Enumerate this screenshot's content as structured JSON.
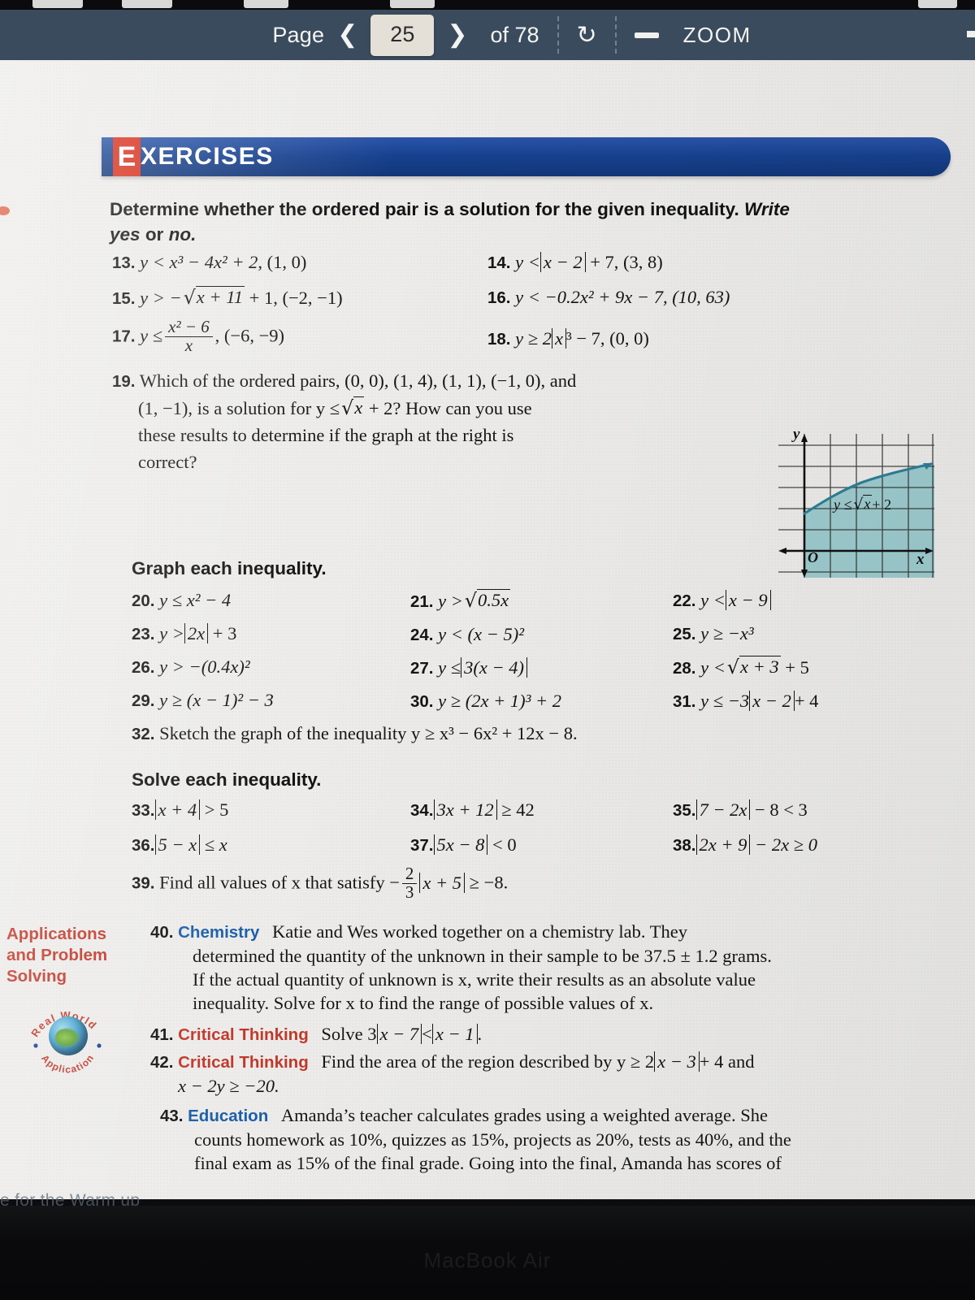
{
  "toolbar": {
    "page_label": "Page",
    "prev_icon": "chevron-left-icon",
    "page_value": "25",
    "next_icon": "chevron-right-icon",
    "of_label": "of 78",
    "reload_icon": "reload-icon",
    "zoom_out_icon": "minus-icon",
    "zoom_label": "ZOOM",
    "bg_color": "#394b5c",
    "page_box_color": "#e4e0d8"
  },
  "banner": {
    "first_letter": "E",
    "rest": "XERCISES",
    "bg_color": "#17418f",
    "accent_color": "#d8301d"
  },
  "section1": {
    "instruction_line1": "Determine whether the ordered pair is a solution for the given inequality.",
    "instruction_italic1": "Write",
    "instruction_italic2": "yes",
    "instruction_plain": "or",
    "instruction_italic3": "no."
  },
  "ex13": {
    "num": "13.",
    "lhs": "y <",
    "expr": "x³ − 4x² + 2",
    "pair": ", (1, 0)"
  },
  "ex14": {
    "num": "14.",
    "lhs": "y <",
    "abs": "x − 2",
    "tail": "+ 7, (3, 8)"
  },
  "ex15": {
    "num": "15.",
    "lhs": "y > −",
    "radicand": "x + 11",
    "tail": "+ 1, (−2, −1)"
  },
  "ex16": {
    "num": "16.",
    "text": "y < −0.2x² + 9x − 7, (10, 63)"
  },
  "ex17": {
    "num": "17.",
    "lhs": "y ≤",
    "frac_num": "x² − 6",
    "frac_den": "x",
    "tail": ", (−6, −9)"
  },
  "ex18": {
    "num": "18.",
    "lhs": "y ≥ 2",
    "abs": "x",
    "tail": "³ − 7, (0, 0)"
  },
  "ex19": {
    "num": "19.",
    "line1": "Which of the ordered pairs, (0, 0), (1, 4), (1, 1), (−1, 0), and",
    "line2a": "(1, −1), is a solution for y ≤",
    "line2b": "x",
    "line2c": "+ 2? How can you use",
    "line3": "these results to determine if the graph at the right is",
    "line4": "correct?",
    "figure": {
      "name": "inequality-graph",
      "y_axis_label": "y",
      "x_axis_label": "x",
      "origin_label": "O",
      "curve_label_prefix": "y ≤",
      "curve_label_radicand": "x",
      "curve_label_suffix": "+ 2",
      "shade_color": "#8ec6c9",
      "curve_color": "#2d7f96"
    }
  },
  "section2": {
    "heading": "Graph each inequality."
  },
  "ex20": {
    "num": "20.",
    "text": "y ≤ x² − 4"
  },
  "ex21": {
    "num": "21.",
    "lhs": "y >",
    "radicand": "0.5x"
  },
  "ex22": {
    "num": "22.",
    "lhs": "y <",
    "abs": "x − 9"
  },
  "ex23": {
    "num": "23.",
    "lhs": "y >",
    "abs": "2x",
    "tail": "+ 3"
  },
  "ex24": {
    "num": "24.",
    "text": "y < (x − 5)²"
  },
  "ex25": {
    "num": "25.",
    "text": "y ≥ −x³"
  },
  "ex26": {
    "num": "26.",
    "text": "y > −(0.4x)²"
  },
  "ex27": {
    "num": "27.",
    "lhs": "y ≤",
    "abs": "3(x − 4)"
  },
  "ex28": {
    "num": "28.",
    "lhs": "y <",
    "radicand": "x + 3",
    "tail": "+ 5"
  },
  "ex29": {
    "num": "29.",
    "text": "y ≥ (x − 1)² − 3"
  },
  "ex30": {
    "num": "30.",
    "text": "y ≥ (2x + 1)³ + 2"
  },
  "ex31": {
    "num": "31.",
    "lhs": "y ≤ −3",
    "abs": "x − 2",
    "tail": "+ 4"
  },
  "ex32": {
    "num": "32.",
    "text": "Sketch the graph of the inequality y ≥ x³ − 6x² + 12x − 8."
  },
  "section3": {
    "heading": "Solve each inequality."
  },
  "ex33": {
    "num": "33.",
    "abs": "x + 4",
    "tail": "> 5"
  },
  "ex34": {
    "num": "34.",
    "abs": "3x + 12",
    "tail": "≥ 42"
  },
  "ex35": {
    "num": "35.",
    "abs": "7 − 2x",
    "tail": "− 8 < 3"
  },
  "ex36": {
    "num": "36.",
    "abs": "5 − x",
    "tail": "≤ x"
  },
  "ex37": {
    "num": "37.",
    "abs": "5x − 8",
    "tail": "< 0"
  },
  "ex38": {
    "num": "38.",
    "abs": "2x + 9",
    "tail": "− 2x ≥ 0"
  },
  "ex39": {
    "num": "39.",
    "lead": "Find all values of x that satisfy −",
    "frac_num": "2",
    "frac_den": "3",
    "abs": "x + 5",
    "tail": "≥ −8."
  },
  "sidebar": {
    "line1": "Applications",
    "line2": "and Problem",
    "line3": "Solving",
    "badge_top": "Real World",
    "badge_bottom": "Application",
    "badge_icon": "globe-icon",
    "color": "#c0392b"
  },
  "ex40": {
    "num": "40.",
    "tag": "Chemistry",
    "tag_color": "#1b5fa8",
    "line1": "Katie and Wes worked together on a chemistry lab. They",
    "line2": "determined the quantity of the unknown in their sample to be 37.5 ± 1.2 grams.",
    "line3": "If the actual quantity of unknown is x, write their results as an absolute value",
    "line4": "inequality. Solve for x to find the range of possible values of x."
  },
  "ex41": {
    "num": "41.",
    "tag": "Critical Thinking",
    "tag_color": "#c0392b",
    "lead": "Solve 3",
    "abs1": "x − 7",
    "mid": "<",
    "abs2": "x − 1",
    "tail": "."
  },
  "ex42": {
    "num": "42.",
    "tag": "Critical Thinking",
    "tag_color": "#c0392b",
    "lead": "Find the area of the region described by y ≥ 2",
    "abs": "x − 3",
    "tail": "+ 4 and",
    "line2": "x − 2y ≥ −20."
  },
  "ex43": {
    "num": "43.",
    "tag": "Education",
    "tag_color": "#1b5fa8",
    "line1": "Amanda’s teacher calculates grades using a weighted average. She",
    "line2": "counts homework as 10%, quizzes as 15%, projects as 20%, tests as 40%, and the",
    "line3": "final exam as 15% of the final grade. Going into the final, Amanda has scores of"
  },
  "footer": {
    "partial_text": "e for the Warm up",
    "device_watermark": "MacBook Air"
  }
}
